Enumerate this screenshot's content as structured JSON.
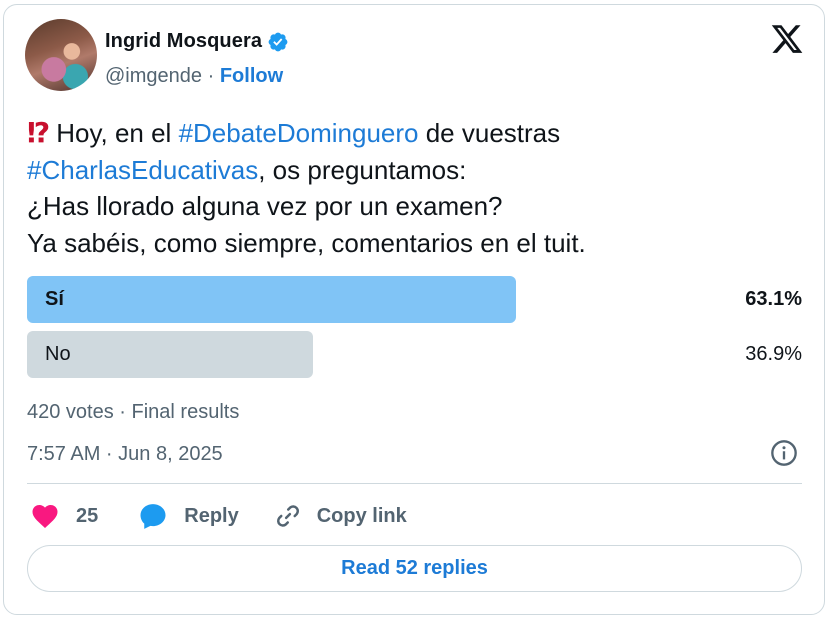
{
  "author": {
    "name": "Ingrid Mosquera",
    "handle": "@imgende",
    "separator": "·",
    "follow_label": "Follow",
    "verified": true
  },
  "tweet": {
    "emoji": "⁉",
    "line1_pre": "Hoy, en el ",
    "hashtag1": "#DebateDominguero",
    "line1_post": " de vuestras",
    "hashtag2": "#CharlasEducativas",
    "line2_post": ", os preguntamos:",
    "line3": "¿Has llorado alguna vez por un examen?",
    "line4": "Ya sabéis, como siempre, comentarios en el tuit."
  },
  "poll": {
    "options": [
      {
        "label": "Sí",
        "percent_text": "63.1%",
        "percent": 63.1,
        "winner": true,
        "color": "#80c4f6"
      },
      {
        "label": "No",
        "percent_text": "36.9%",
        "percent": 36.9,
        "winner": false,
        "color": "#cfd9de"
      }
    ],
    "summary": "420 votes · Final results"
  },
  "timestamp": "7:57 AM · Jun 8, 2025",
  "actions": {
    "like_count": "25",
    "reply_label": "Reply",
    "copy_label": "Copy link"
  },
  "read_replies_label": "Read 52 replies",
  "colors": {
    "accent": "#1d7bd6",
    "like": "#f91880",
    "reply_bubble": "#1d9bf0",
    "muted": "#536471"
  },
  "icons": [
    "verified-badge-icon",
    "x-logo-icon",
    "info-icon",
    "heart-icon",
    "reply-bubble-icon",
    "link-icon"
  ]
}
